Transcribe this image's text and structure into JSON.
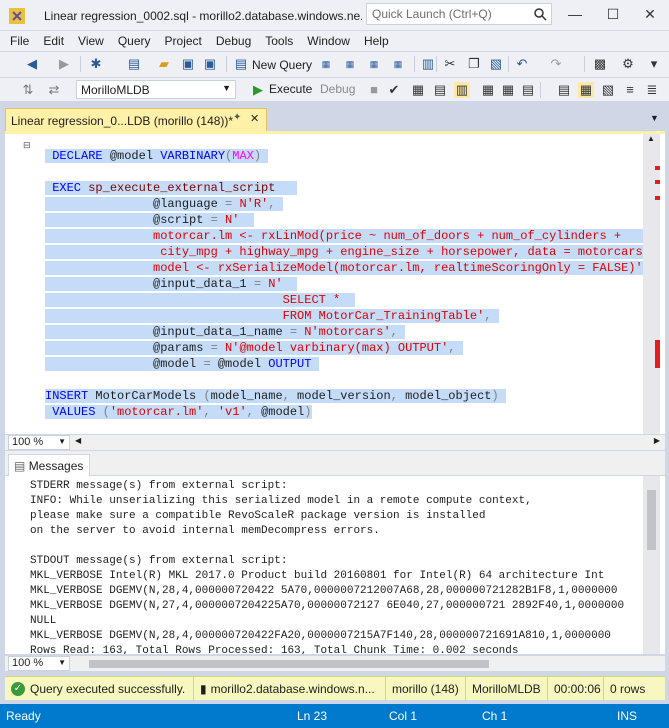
{
  "window": {
    "title": "Linear regression_0002.sql - morillo2.database.windows.ne...",
    "quick_launch_placeholder": "Quick Launch (Ctrl+Q)"
  },
  "menu": [
    "File",
    "Edit",
    "View",
    "Query",
    "Project",
    "Debug",
    "Tools",
    "Window",
    "Help"
  ],
  "toolbar": {
    "new_query": "New Query",
    "database": "MorilloMLDB",
    "execute": "Execute",
    "debug": "Debug"
  },
  "doc_tab": {
    "label": "Linear regression_0...LDB (morillo (148))*"
  },
  "editor": {
    "zoom": "100 %",
    "lines": [
      "DECLARE @model VARBINARY(MAX)",
      "",
      "EXEC sp_execute_external_script",
      "              @language = N'R',",
      "              @script = N'",
      "              motorcar.lm <- rxLinMod(price ~ num_of_doors + num_of_cylinders +",
      "               city_mpg + highway_mpg + engine_size + horsepower, data = motorcars)",
      "              model <- rxSerializeModel(motorcar.lm, realtimeScoringOnly = FALSE)',",
      "              @input_data_1 = N'",
      "                              SELECT *",
      "                              FROM MotorCar_TrainingTable',",
      "              @input_data_1_name = N'motorcars',",
      "              @params = N'@model varbinary(max) OUTPUT',",
      "              @model = @model OUTPUT",
      "",
      "INSERT MotorCarModels (model_name, model_version, model_object)",
      " VALUES ('motorcar.lm', 'v1', @model)"
    ]
  },
  "results": {
    "tab": "Messages",
    "zoom": "100 %",
    "lines": [
      "STDERR message(s) from external script:",
      "INFO: While unserializing this serialized model in a remote compute context,",
      "please make sure a compatible RevoScaleR package version is installed",
      "on the server to avoid internal memDecompress errors.",
      "",
      "STDOUT message(s) from external script:",
      "MKL_VERBOSE Intel(R) MKL 2017.0 Product build 20160801 for Intel(R) 64 architecture Int",
      "MKL_VERBOSE DGEMV(N,28,4,000000720422 5A70,0000007212007A68,28,000000721282B1F8,1,0000000",
      "MKL_VERBOSE DGEMV(N,27,4,0000007204225A70,00000072127 6E040,27,000000721 2892F40,1,0000000",
      "NULL",
      "MKL_VERBOSE DGEMV(N,28,4,000000720422FA20,0000007215A7F140,28,000000721691A810,1,0000000",
      "Rows Read: 163, Total Rows Processed: 163, Total Chunk Time: 0.002 seconds"
    ]
  },
  "query_status": {
    "message": "Query executed successfully.",
    "server": "morillo2.database.windows.n...",
    "user": "morillo (148)",
    "database": "MorilloMLDB",
    "time": "00:00:06",
    "rows": "0 rows"
  },
  "statusbar": {
    "ready": "Ready",
    "ln": "Ln 23",
    "col": "Col 1",
    "ch": "Ch 1",
    "ins": "INS"
  },
  "colors": {
    "accent": "#007acc",
    "tab_active": "#fff1a8",
    "selection": "#c4dcf7",
    "status_strip": "#f6f8bf"
  }
}
